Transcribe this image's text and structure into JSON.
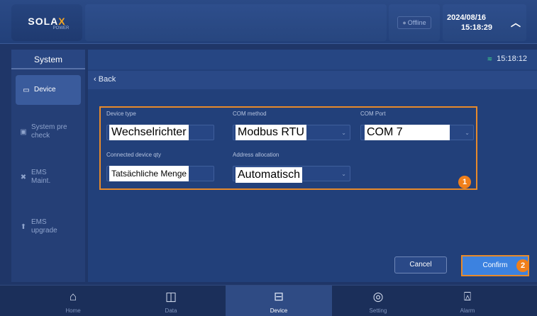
{
  "header": {
    "logo": "SOLAX",
    "logo_sub": "POWER",
    "status": "Offline",
    "date": "2024/08/16",
    "time": "15:18:29"
  },
  "sidebar": {
    "title": "System",
    "items": [
      {
        "label": "Device",
        "icon": "monitor-icon",
        "active": true
      },
      {
        "label": "System pre check",
        "icon": "checklist-icon",
        "active": false
      },
      {
        "label": "EMS Maint.",
        "icon": "wrench-icon",
        "active": false
      },
      {
        "label": "EMS upgrade",
        "icon": "upload-icon",
        "active": false
      }
    ]
  },
  "subbar": {
    "clock": "15:18:12",
    "signal_icon": "signal-icon"
  },
  "backbar": {
    "back_label": "Back"
  },
  "form": {
    "device_type_label": "Device type",
    "device_type_value": "Wechselrichter",
    "com_method_label": "COM method",
    "com_method_value": "Modbus RTU",
    "com_port_label": "COM Port",
    "com_port_value": "COM 7",
    "qty_label": "Connected device qty",
    "qty_value": "Tatsächliche Menge",
    "address_label": "Address allocation",
    "address_value": "Automatisch",
    "annotation_1": "1",
    "annotation_2": "2"
  },
  "buttons": {
    "cancel": "Cancel",
    "confirm": "Confirm"
  },
  "bottom_nav": [
    {
      "label": "Home",
      "icon": "home-icon",
      "active": false
    },
    {
      "label": "Data",
      "icon": "chart-icon",
      "active": false
    },
    {
      "label": "Device",
      "icon": "device-icon",
      "active": true
    },
    {
      "label": "Setting",
      "icon": "settings-icon",
      "active": false
    },
    {
      "label": "Alarm",
      "icon": "alarm-icon",
      "active": false
    }
  ],
  "colors": {
    "accent_orange": "#e88a2a",
    "primary_blue": "#3c82e0",
    "background": "#1f3668"
  }
}
